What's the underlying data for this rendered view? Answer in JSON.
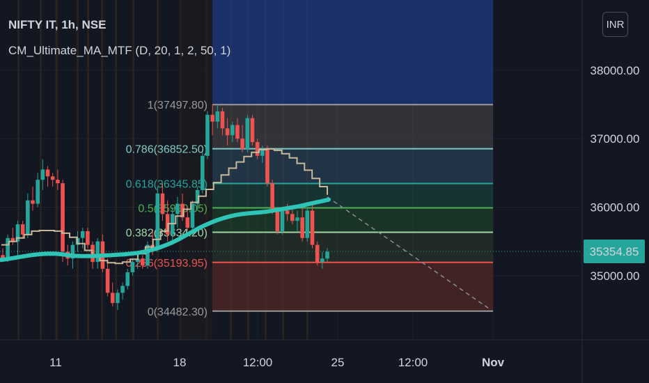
{
  "header": {
    "symbol": "NIFTY IT, 1h, NSE",
    "indicator": "CM_Ultimate_MA_MTF (D, 20, 1, 2, 50, 1)"
  },
  "currency_label": "INR",
  "colors": {
    "background": "#131722",
    "up": "#26a69a",
    "down": "#ef5350",
    "ma": "#2ec4b6",
    "step_ma": "#c8b99a",
    "grid": "#1e222d",
    "session": "#3a2a1e"
  },
  "chart_data": {
    "type": "candlestick",
    "x_ticks": [
      "11",
      "18",
      "12:00",
      "25",
      "12:00",
      "Nov"
    ],
    "y_ticks": [
      "38000.00",
      "37000.00",
      "36000.00",
      "35000.00"
    ],
    "ylim": [
      34200,
      38900
    ],
    "last_price": "35354.85",
    "fibonacci": [
      {
        "label": "1(37497.80)",
        "level": 37497.8,
        "color": "#9a9a9a"
      },
      {
        "label": "0.786(36852.50)",
        "level": 36852.5,
        "color": "#80cbc4"
      },
      {
        "label": "0.618(36345.85)",
        "level": 36345.85,
        "color": "#26a69a"
      },
      {
        "label": "0.5(35990.05)",
        "level": 35990.05,
        "color": "#4caf50"
      },
      {
        "label": "0.382(35634.20)",
        "level": 35634.2,
        "color": "#a5d6a7"
      },
      {
        "label": "0.236(35193.95)",
        "level": 35193.95,
        "color": "#ef5350"
      },
      {
        "label": "0(34482.30)",
        "level": 34482.3,
        "color": "#9a9a9a"
      }
    ],
    "candles": [
      [
        35300,
        35400,
        35200,
        35250
      ],
      [
        35250,
        35600,
        35200,
        35550
      ],
      [
        35550,
        35700,
        35450,
        35500
      ],
      [
        35500,
        35800,
        35300,
        35750
      ],
      [
        35750,
        35800,
        35550,
        35600
      ],
      [
        35600,
        36200,
        35550,
        36100
      ],
      [
        36100,
        36300,
        35950,
        36050
      ],
      [
        36050,
        36500,
        36000,
        36400
      ],
      [
        36400,
        36700,
        36250,
        36550
      ],
      [
        36550,
        36600,
        36300,
        36450
      ],
      [
        36450,
        36500,
        36300,
        36400
      ],
      [
        36400,
        36550,
        36250,
        36350
      ],
      [
        36350,
        36400,
        35200,
        35350
      ],
      [
        35350,
        35450,
        35150,
        35250
      ],
      [
        35250,
        35500,
        35100,
        35450
      ],
      [
        35450,
        35650,
        35350,
        35550
      ],
      [
        35550,
        35700,
        35400,
        35650
      ],
      [
        35650,
        35700,
        35400,
        35450
      ],
      [
        35450,
        35500,
        35100,
        35200
      ],
      [
        35200,
        35550,
        35100,
        35500
      ],
      [
        35500,
        35600,
        35050,
        35100
      ],
      [
        35100,
        35250,
        34700,
        34750
      ],
      [
        34750,
        34900,
        34550,
        34600
      ],
      [
        34600,
        34800,
        34500,
        34750
      ],
      [
        34750,
        34900,
        34650,
        34850
      ],
      [
        34850,
        35100,
        34800,
        35050
      ],
      [
        35050,
        35250,
        35000,
        35200
      ],
      [
        35200,
        35350,
        35100,
        35250
      ],
      [
        35250,
        35300,
        35100,
        35150
      ],
      [
        35150,
        35500,
        35100,
        35450
      ],
      [
        35450,
        35650,
        35300,
        35400
      ],
      [
        35400,
        36300,
        35350,
        36200
      ],
      [
        36200,
        36350,
        35800,
        35900
      ],
      [
        35900,
        36100,
        35500,
        35600
      ],
      [
        35600,
        36000,
        35450,
        35900
      ],
      [
        35900,
        36150,
        35700,
        36050
      ],
      [
        36050,
        36200,
        35800,
        35850
      ],
      [
        35850,
        36000,
        35650,
        35700
      ],
      [
        35700,
        36100,
        35650,
        36050
      ],
      [
        36050,
        36300,
        35950,
        36250
      ],
      [
        36250,
        36800,
        36200,
        36750
      ],
      [
        36750,
        37400,
        36700,
        37350
      ],
      [
        37350,
        37500,
        37050,
        37250
      ],
      [
        37250,
        37500,
        37150,
        37400
      ],
      [
        37400,
        37450,
        37050,
        37150
      ],
      [
        37150,
        37300,
        36900,
        37050
      ],
      [
        37050,
        37250,
        36950,
        37200
      ],
      [
        37200,
        37300,
        36950,
        37000
      ],
      [
        37000,
        37200,
        36800,
        36850
      ],
      [
        36850,
        37350,
        36800,
        37300
      ],
      [
        37300,
        37350,
        36900,
        36950
      ],
      [
        36950,
        37000,
        36700,
        36750
      ],
      [
        36750,
        36900,
        36650,
        36850
      ],
      [
        36850,
        36900,
        36300,
        36350
      ],
      [
        36350,
        36400,
        35900,
        35950
      ],
      [
        35950,
        36000,
        35600,
        35650
      ],
      [
        35650,
        36000,
        35600,
        35950
      ],
      [
        35950,
        36050,
        35800,
        35900
      ],
      [
        35900,
        36000,
        35750,
        35800
      ],
      [
        35800,
        35950,
        35650,
        35850
      ],
      [
        35850,
        36000,
        35500,
        35550
      ],
      [
        35550,
        36000,
        35500,
        35950
      ],
      [
        35950,
        36050,
        35400,
        35450
      ],
      [
        35450,
        35500,
        35150,
        35200
      ],
      [
        35200,
        35350,
        35100,
        35250
      ],
      [
        35250,
        35400,
        35200,
        35350
      ]
    ],
    "ma_values": [
      35230,
      35240,
      35255,
      35270,
      35285,
      35300,
      35310,
      35318,
      35322,
      35320,
      35312,
      35300,
      35290,
      35285,
      35285,
      35288,
      35292,
      35296,
      35300,
      35306,
      35312,
      35320,
      35330,
      35345,
      35365,
      35390,
      35420,
      35455,
      35495,
      35540,
      35590,
      35640,
      35690,
      35735,
      35775,
      35810,
      35840,
      35865,
      35885,
      35900,
      35910,
      35918,
      35925,
      35935,
      35950,
      35965,
      35980,
      35995,
      36010,
      36030,
      36050,
      36070,
      36090,
      36110
    ],
    "step_ma": [
      35450,
      35500,
      35550,
      35600,
      35650,
      35660,
      35660,
      35650,
      35620,
      35560,
      35470,
      35370,
      35280,
      35220,
      35190,
      35180,
      35200,
      35240,
      35320,
      35420,
      35530,
      35650,
      35760,
      35870,
      35970,
      36070,
      36160,
      36260,
      36360,
      36470,
      36570,
      36660,
      36740,
      36800,
      36840,
      36850,
      36830,
      36780,
      36720,
      36640,
      36540,
      36420,
      36300,
      36180
    ]
  }
}
